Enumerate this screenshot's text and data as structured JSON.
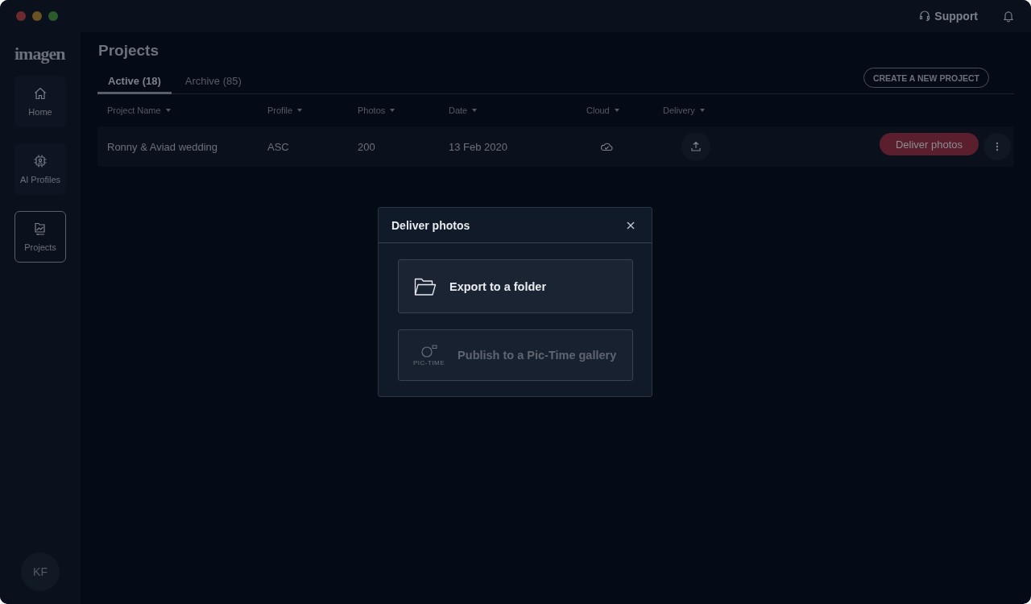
{
  "topbar": {
    "support": "Support"
  },
  "sidebar": {
    "logo": "imagen",
    "items": [
      {
        "label": "Home",
        "kind": "home",
        "selected": false
      },
      {
        "label": "AI Profiles",
        "kind": "profile",
        "selected": false
      },
      {
        "label": "Projects",
        "kind": "projects",
        "selected": true
      }
    ],
    "avatar": "KF"
  },
  "page": {
    "title": "Projects",
    "tabs": [
      {
        "label": "Active (18)",
        "selected": true
      },
      {
        "label": "Archive (85)",
        "selected": false
      }
    ],
    "create_button": "CREATE A NEW PROJECT"
  },
  "table": {
    "columns": [
      "Project Name",
      "Profile",
      "Photos",
      "Date",
      "Cloud",
      "Delivery"
    ],
    "rows": [
      {
        "name": "Ronny & Aviad wedding",
        "profile": "ASC",
        "photos": "200",
        "date": "13 Feb 2020",
        "action": "Deliver photos"
      }
    ]
  },
  "modal": {
    "title": "Deliver photos",
    "options": [
      {
        "kind": "folder",
        "label": "Export to a folder",
        "disabled": false
      },
      {
        "kind": "pictime",
        "label": "Publish to a Pic-Time gallery",
        "logo_text": "PIC-TIME",
        "disabled": true
      }
    ]
  }
}
